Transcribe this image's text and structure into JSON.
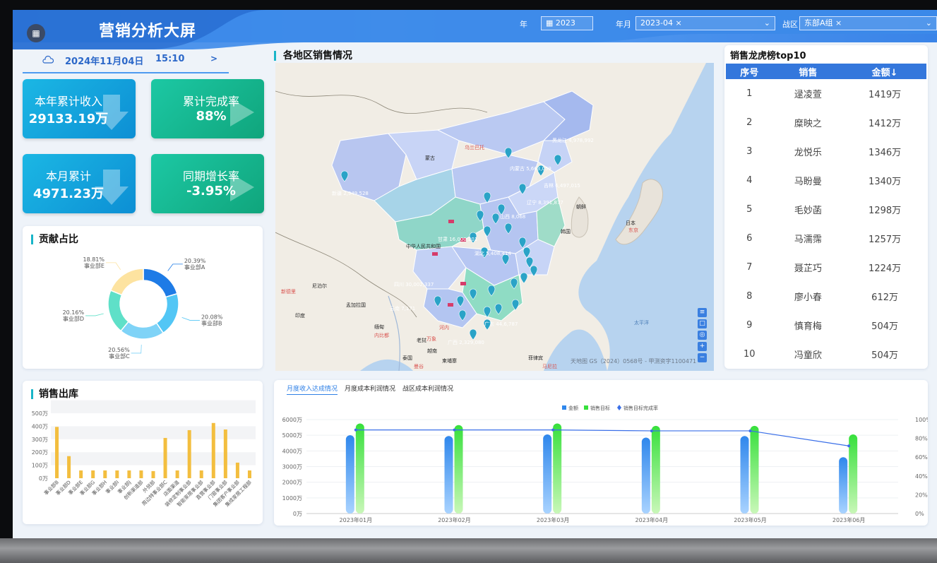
{
  "header": {
    "title": "营销分析大屏",
    "menu_icon": "grid-icon",
    "filters": {
      "year_label": "年",
      "year_value": "2023",
      "month_label": "年月",
      "month_value": "2023-04 ×",
      "zone_label": "战区",
      "zone_value": "东部A组 ×"
    }
  },
  "date_bar": {
    "date": "2024年11月04日",
    "time": "15:10",
    "next": ">"
  },
  "kpis": [
    {
      "label": "本年累计收入",
      "value": "29133.19万",
      "color": "blue"
    },
    {
      "label": "累计完成率",
      "value": "88%",
      "color": "green"
    },
    {
      "label": "本月累计",
      "value": "4971.23万",
      "color": "blue"
    },
    {
      "label": "同期增长率",
      "value": "-3.95%",
      "color": "green"
    }
  ],
  "contribution": {
    "title": "贡献占比",
    "chart_data": {
      "type": "pie",
      "slices": [
        {
          "name": "事业部A",
          "value": 20.39,
          "label": "20.39%",
          "color": "#1e7be6"
        },
        {
          "name": "事业部B",
          "value": 20.08,
          "label": "20.08%",
          "color": "#52c6f5"
        },
        {
          "name": "事业部C",
          "value": 20.56,
          "label": "20.56%",
          "color": "#7fd3f7"
        },
        {
          "name": "事业部D",
          "value": 20.16,
          "label": "20.16%",
          "color": "#5fe0c8"
        },
        {
          "name": "事业部E",
          "value": 18.81,
          "label": "18.81%",
          "color": "#fde3a0"
        }
      ]
    }
  },
  "outbound": {
    "title": "销售出库",
    "chart_data": {
      "type": "bar",
      "categories": [
        "事业部B",
        "事业部D",
        "事业部E",
        "事业部G",
        "事业部H",
        "事业部I",
        "事业部J",
        "创新渠道部",
        "外贸部",
        "周边特事业部C",
        "店面渠道",
        "装修定制事业部",
        "智能家居事业部",
        "直营事业部",
        "门窗事业部",
        "集团客户事业部",
        "集成家居工程部"
      ],
      "values": [
        395,
        170,
        60,
        60,
        60,
        60,
        60,
        60,
        55,
        310,
        60,
        370,
        60,
        425,
        375,
        120,
        60
      ],
      "ylim": [
        0,
        500
      ],
      "yticks": [
        "0万",
        "100万",
        "200万",
        "300万",
        "400万",
        "500万"
      ],
      "color": "#f3be3f"
    }
  },
  "map": {
    "title": "各地区销售情况",
    "credit": "天地图 GS（2024）0568号 - 甲测资字1100471",
    "tools": [
      "list-icon",
      "square-icon",
      "locate-icon",
      "plus-icon",
      "minus-icon"
    ],
    "country_labels": [
      "蒙古",
      "中华人民共和国",
      "尼泊尔",
      "印度",
      "孟加拉国",
      "缅甸",
      "老挝",
      "泰国",
      "越南",
      "柬埔寨",
      "菲律宾",
      "朝鲜",
      "韩国",
      "日本",
      "太平洋"
    ],
    "city_labels": [
      "乌兰巴托",
      "新德里",
      "东京",
      "马尼拉",
      "曼谷",
      "河内",
      "万象",
      "内比都"
    ],
    "region_values": [
      "新疆 2,949,528",
      "黑龙江 4,978,992",
      "内蒙古 5,663,059",
      "吉林 6,497,015",
      "辽宁 8,391,877",
      "四川 30,002,337",
      "广东 44,6,787",
      "云南 7,171",
      "广西 2,329,080",
      "湖北 5,408,414",
      "山西 8,068",
      "甘肃 16,000,201"
    ]
  },
  "leaderboard": {
    "title": "销售龙虎榜top10",
    "columns": [
      "序号",
      "销售",
      "金额↓"
    ],
    "rows": [
      [
        "1",
        "逯凌萱",
        "1419万"
      ],
      [
        "2",
        "糜映之",
        "1412万"
      ],
      [
        "3",
        "龙悦乐",
        "1346万"
      ],
      [
        "4",
        "马盼曼",
        "1340万"
      ],
      [
        "5",
        "毛妙菡",
        "1298万"
      ],
      [
        "6",
        "马濡霈",
        "1257万"
      ],
      [
        "7",
        "聂芷巧",
        "1224万"
      ],
      [
        "8",
        "廖小春",
        "612万"
      ],
      [
        "9",
        "慎育梅",
        "504万"
      ],
      [
        "10",
        "冯童欣",
        "504万"
      ]
    ]
  },
  "combo": {
    "tabs": [
      "月度收入达成情况",
      "月度成本利润情况",
      "战区成本利润情况"
    ],
    "active_tab": 0,
    "legend": [
      "金额",
      "销售目标",
      "销售目标完成率"
    ],
    "chart_data": {
      "type": "bar",
      "categories": [
        "2023年01月",
        "2023年02月",
        "2023年03月",
        "2023年04月",
        "2023年05月",
        "2023年06月"
      ],
      "series": [
        {
          "name": "金额",
          "values": [
            5000,
            4950,
            5050,
            4850,
            4950,
            3600
          ],
          "color": "#2f87ec"
        },
        {
          "name": "销售目标",
          "values": [
            5750,
            5650,
            5750,
            5600,
            5600,
            5050
          ],
          "color": "#37e03c"
        },
        {
          "name": "销售目标完成率",
          "values": [
            89,
            89,
            89,
            88,
            88,
            72
          ],
          "color": "#3a6fe8",
          "axis": "right"
        }
      ],
      "ylim": [
        0,
        6000
      ],
      "yticks": [
        "0万",
        "1000万",
        "2000万",
        "3000万",
        "4000万",
        "5000万",
        "6000万"
      ],
      "y2lim": [
        0,
        100
      ],
      "y2ticks": [
        "0%",
        "20%",
        "40%",
        "60%",
        "80%",
        "100%"
      ]
    }
  }
}
